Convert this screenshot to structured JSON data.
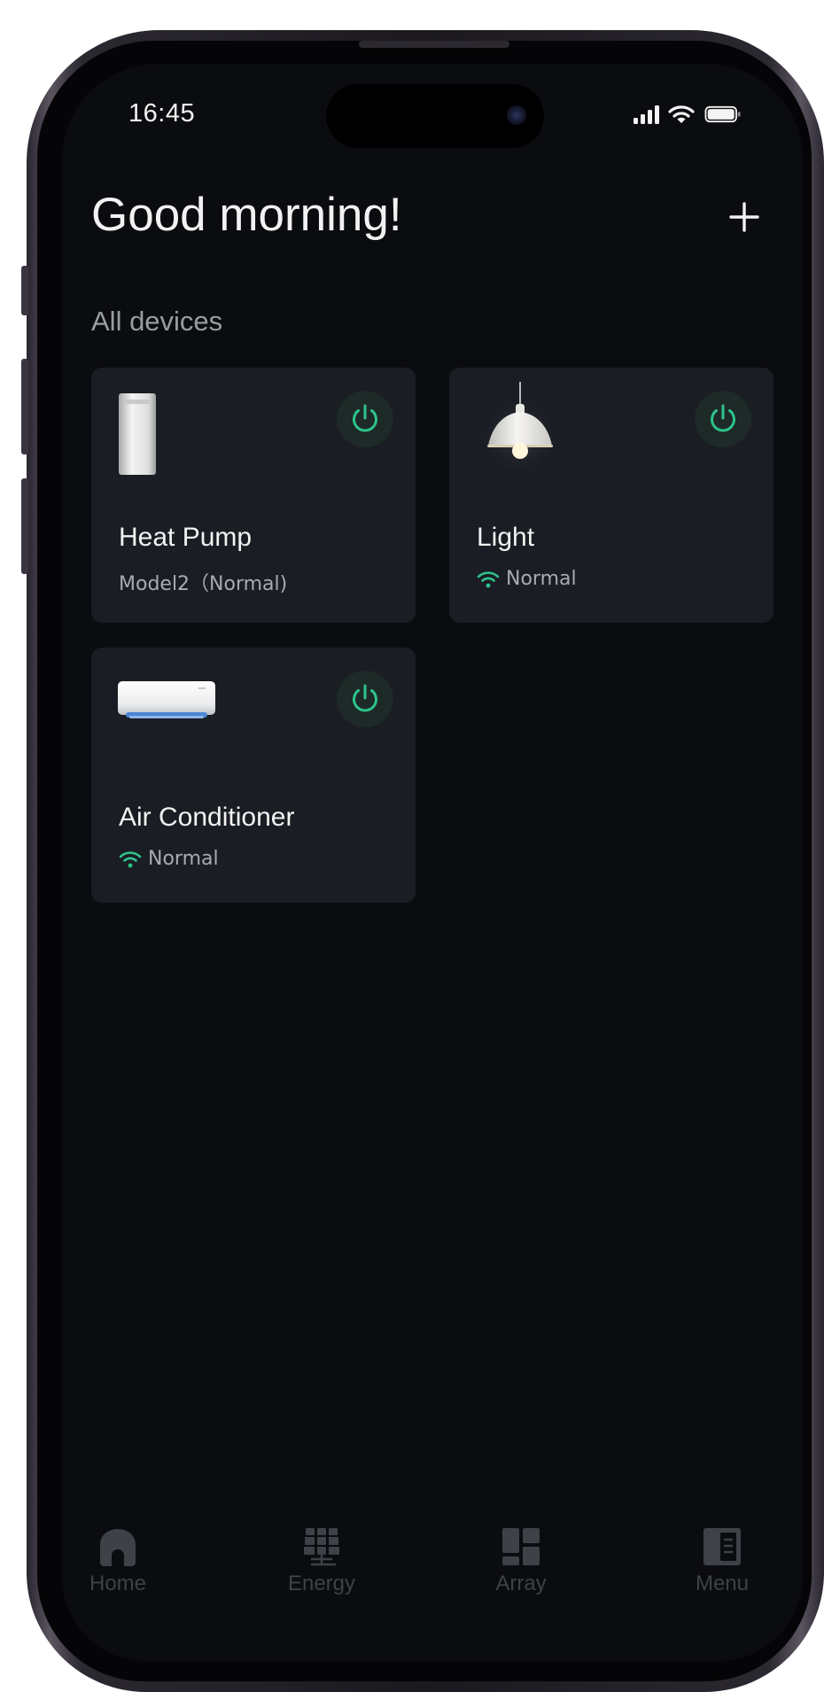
{
  "status_bar": {
    "time": "16:45"
  },
  "header": {
    "greeting": "Good morning!",
    "add_icon": "plus-icon"
  },
  "section_title": "All devices",
  "devices": [
    {
      "name": "Heat Pump",
      "status": "Model2（Normal)",
      "icon": "heat-pump-icon",
      "power_icon": "power-icon",
      "wifi": false
    },
    {
      "name": "Light",
      "status": "Normal",
      "icon": "lamp-icon",
      "power_icon": "power-icon",
      "wifi": true
    },
    {
      "name": "Air Conditioner",
      "status": "Normal",
      "icon": "air-conditioner-icon",
      "power_icon": "power-icon",
      "wifi": true
    }
  ],
  "tabs": [
    {
      "label": "Home",
      "icon": "home-icon"
    },
    {
      "label": "Energy",
      "icon": "energy-icon"
    },
    {
      "label": "Array",
      "icon": "array-icon"
    },
    {
      "label": "Menu",
      "icon": "menu-icon"
    }
  ],
  "colors": {
    "background": "#0b0c0f",
    "card": "#1a1d23",
    "accent_green": "#2fc38a",
    "text_primary": "#f2f2f2",
    "text_secondary": "#9a9ca3",
    "tab_inactive": "#3f4148"
  }
}
